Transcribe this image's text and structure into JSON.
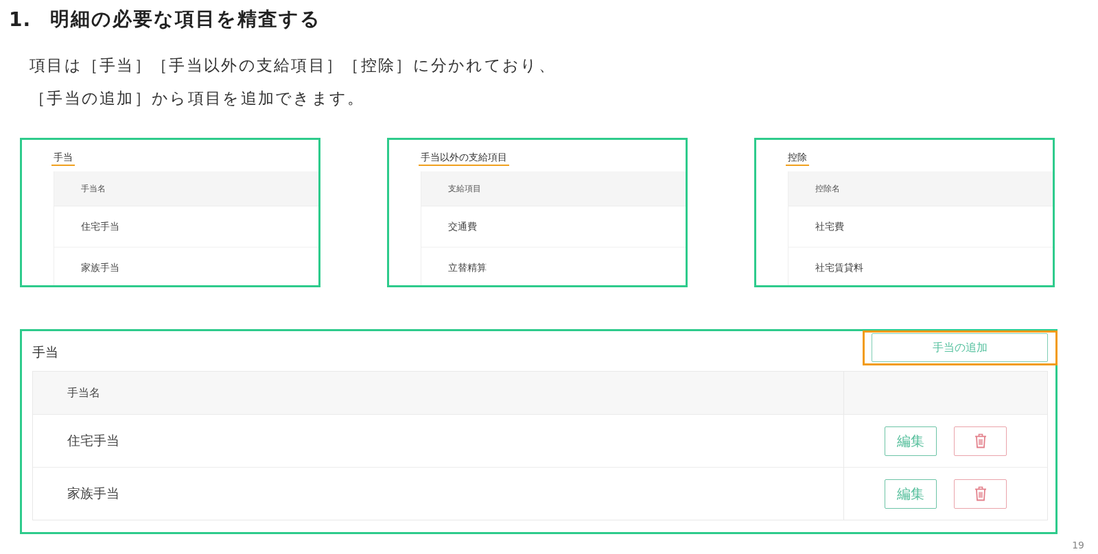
{
  "heading": {
    "number": "1.",
    "title": "明細の必要な項目を精査する"
  },
  "description_lines": [
    "項目は［手当］［手当以外の支給項目］［控除］に分かれており、",
    "［手当の追加］から項目を追加できます。"
  ],
  "previews": [
    {
      "tab": {
        "label": "手当",
        "selected": true
      },
      "columns": [
        "手当名"
      ],
      "rows": [
        "住宅手当",
        "家族手当"
      ]
    },
    {
      "tab": {
        "label": "手当以外の支給項目",
        "selected": true
      },
      "columns": [
        "支給項目"
      ],
      "rows": [
        "交通費",
        "立替精算"
      ]
    },
    {
      "tab": {
        "label": "控除",
        "selected": true
      },
      "columns": [
        "控除名"
      ],
      "rows": [
        "社宅費",
        "社宅賃貸料"
      ]
    }
  ],
  "editor": {
    "title": "手当",
    "add_button": {
      "label": "手当の追加",
      "highlighted": true
    },
    "columns": [
      "手当名"
    ],
    "rows": [
      {
        "name": "住宅手当",
        "edit_button": "編集"
      },
      {
        "name": "家族手当",
        "edit_button": "編集"
      }
    ]
  },
  "page_number": "19"
}
